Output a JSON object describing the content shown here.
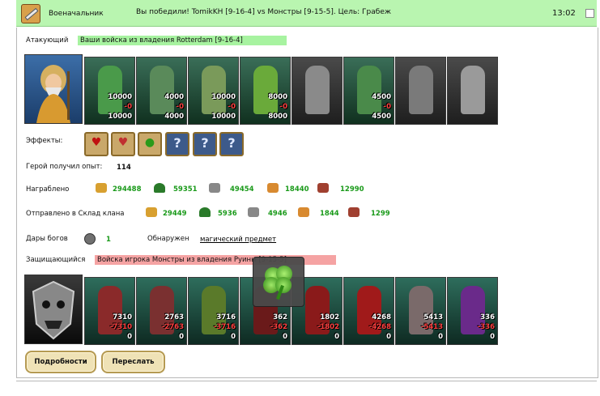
{
  "header": {
    "role": "Военачальник",
    "message": "Вы победили! TomikKH [9-16-4] vs Монстры [9-15-5]. Цель: Грабеж",
    "time": "13:02"
  },
  "attacker": {
    "label": "Атакующий",
    "army_title": "Ваши войска из владения Rotterdam [9-16-4]",
    "units": [
      {
        "n1": "10000",
        "n2": "-0",
        "n3": "10000"
      },
      {
        "n1": "4000",
        "n2": "-0",
        "n3": "4000"
      },
      {
        "n1": "10000",
        "n2": "-0",
        "n3": "10000"
      },
      {
        "n1": "8000",
        "n2": "-0",
        "n3": "8000"
      },
      {
        "n1": "",
        "n2": "",
        "n3": ""
      },
      {
        "n1": "4500",
        "n2": "-0",
        "n3": "4500"
      },
      {
        "n1": "",
        "n2": "",
        "n3": ""
      },
      {
        "n1": "",
        "n2": "",
        "n3": ""
      }
    ]
  },
  "effects": {
    "label": "Эффекты:",
    "items": [
      "heart-icon",
      "heart-potion-icon",
      "green-potion-icon",
      "?",
      "?",
      "?"
    ]
  },
  "experience": {
    "label": "Герой получил опыт:",
    "value": "114"
  },
  "plundered": {
    "label": "Награблено",
    "values": [
      "294488",
      "59351",
      "49454",
      "18440",
      "12990"
    ]
  },
  "sent": {
    "label": "Отправлено в Склад клана",
    "values": [
      "29449",
      "5936",
      "4946",
      "1844",
      "1299"
    ]
  },
  "gifts": {
    "label": "Дары богов",
    "value": "1",
    "found_label": "Обнаружен",
    "found_link": "магический предмет"
  },
  "defender": {
    "label": "Защищающийся",
    "army_title": "Войска игрока Монстры из владения Руины [9-15-5]",
    "units": [
      {
        "n1": "7310",
        "n2": "-7310",
        "n3": "0"
      },
      {
        "n1": "2763",
        "n2": "-2763",
        "n3": "0"
      },
      {
        "n1": "3716",
        "n2": "-3716",
        "n3": "0"
      },
      {
        "n1": "362",
        "n2": "-362",
        "n3": "0"
      },
      {
        "n1": "1802",
        "n2": "-1802",
        "n3": "0"
      },
      {
        "n1": "4268",
        "n2": "-4268",
        "n3": "0"
      },
      {
        "n1": "5413",
        "n2": "-5413",
        "n3": "0"
      },
      {
        "n1": "336",
        "n2": "-336",
        "n3": "0"
      }
    ]
  },
  "buttons": {
    "details": "Подробности",
    "forward": "Переслать"
  },
  "colors": {
    "header_bg": "#b9f5b0",
    "green_value": "#1a9a1a",
    "loss": "#ff4040"
  }
}
